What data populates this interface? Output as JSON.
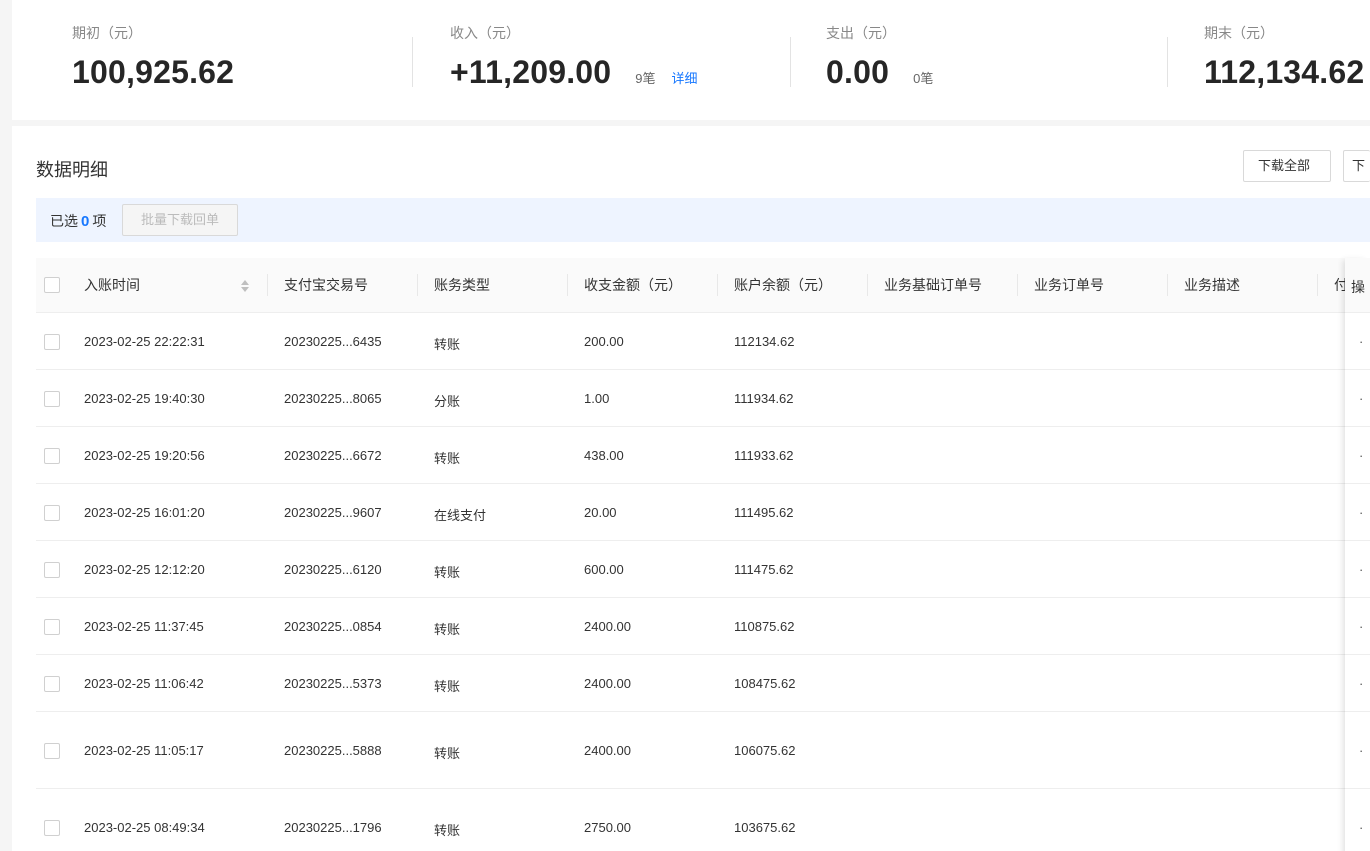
{
  "summary": {
    "opening": {
      "label": "期初（元）",
      "value": "100,925.62"
    },
    "income": {
      "label": "收入（元）",
      "value": "+11,209.00",
      "count": "9笔",
      "link": "详细"
    },
    "expense": {
      "label": "支出（元）",
      "value": "0.00",
      "count": "0笔"
    },
    "closing": {
      "label": "期末（元）",
      "value": "112,134.62"
    }
  },
  "detail": {
    "title": "数据明细",
    "download_all": "下载全部",
    "download_partial": "下",
    "selected_prefix": "已选",
    "selected_count": "0",
    "selected_suffix": "项",
    "batch_download": "批量下载回单"
  },
  "table": {
    "columns": [
      "入账时间",
      "支付宝交易号",
      "账务类型",
      "收支金额（元）",
      "账户余额（元）",
      "业务基础订单号",
      "业务订单号",
      "业务描述",
      "付"
    ],
    "fixed_header": "操",
    "rows": [
      {
        "time": "2023-02-25 22:22:31",
        "trade_no": "20230225...6435",
        "type": "转账",
        "amount": "200.00",
        "balance": "112134.62",
        "op": "·"
      },
      {
        "time": "2023-02-25 19:40:30",
        "trade_no": "20230225...8065",
        "type": "分账",
        "amount": "1.00",
        "balance": "111934.62",
        "op": "·"
      },
      {
        "time": "2023-02-25 19:20:56",
        "trade_no": "20230225...6672",
        "type": "转账",
        "amount": "438.00",
        "balance": "111933.62",
        "op": "·"
      },
      {
        "time": "2023-02-25 16:01:20",
        "trade_no": "20230225...9607",
        "type": "在线支付",
        "amount": "20.00",
        "balance": "111495.62",
        "op": "·"
      },
      {
        "time": "2023-02-25 12:12:20",
        "trade_no": "20230225...6120",
        "type": "转账",
        "amount": "600.00",
        "balance": "111475.62",
        "op": "·"
      },
      {
        "time": "2023-02-25 11:37:45",
        "trade_no": "20230225...0854",
        "type": "转账",
        "amount": "2400.00",
        "balance": "110875.62",
        "op": "·"
      },
      {
        "time": "2023-02-25 11:06:42",
        "trade_no": "20230225...5373",
        "type": "转账",
        "amount": "2400.00",
        "balance": "108475.62",
        "op": "·"
      },
      {
        "time": "2023-02-25 11:05:17",
        "trade_no": "20230225...5888",
        "type": "转账",
        "amount": "2400.00",
        "balance": "106075.62",
        "op": "·"
      },
      {
        "time": "2023-02-25 08:49:34",
        "trade_no": "20230225...1796",
        "type": "转账",
        "amount": "2750.00",
        "balance": "103675.62",
        "op": "·"
      }
    ]
  }
}
